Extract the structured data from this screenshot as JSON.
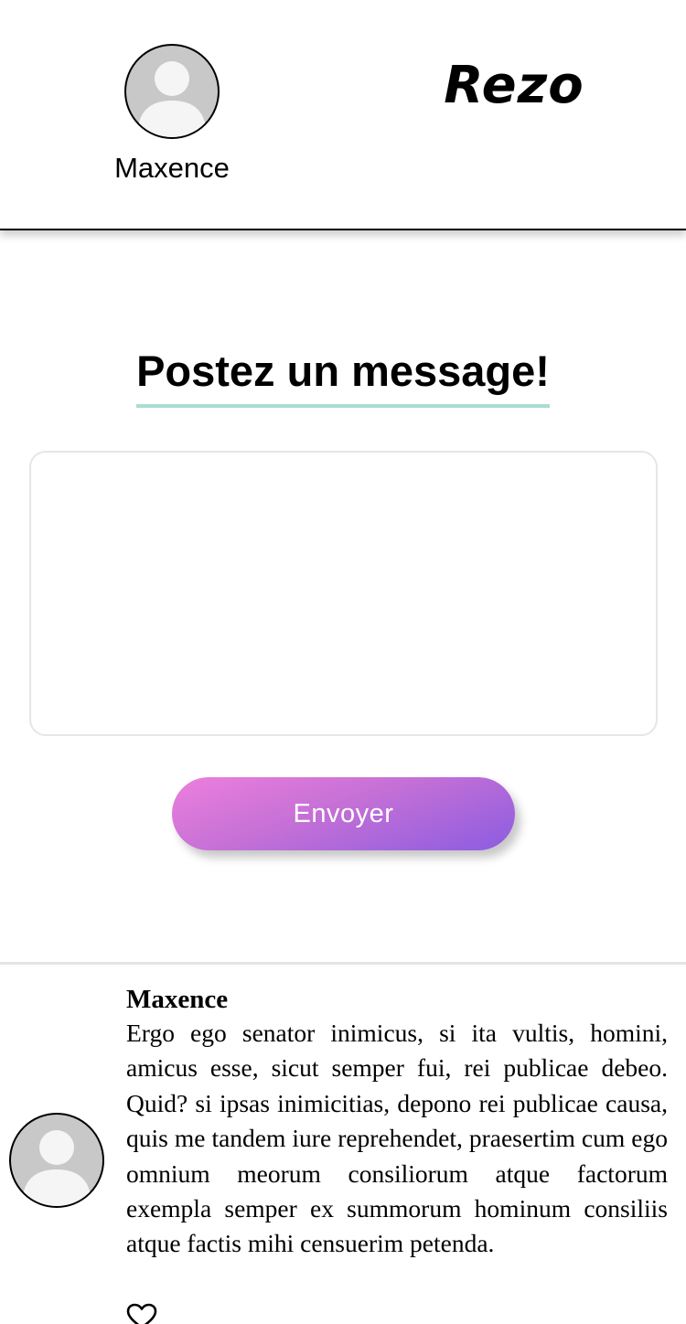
{
  "header": {
    "profile": {
      "name": "Maxence",
      "avatar_icon": "user-avatar-icon"
    },
    "brand": "Rezo"
  },
  "compose": {
    "title": "Postez un message!",
    "message_value": "",
    "send_label": "Envoyer"
  },
  "feed": {
    "posts": [
      {
        "author": "Maxence",
        "text": "Ergo ego senator inimicus, si ita vultis, homini, amicus esse, sicut semper fui, rei publicae debeo. Quid? si ipsas inimicitias, depono rei publicae causa, quis me tandem iure reprehendet, praesertim cum ego omnium meorum consiliorum atque factorum exempla semper ex summorum hominum consiliis atque factis mihi censuerim petenda.",
        "avatar_icon": "user-avatar-icon",
        "like_icon": "heart-outline-icon"
      }
    ]
  },
  "colors": {
    "title_underline": "#a9ddd3",
    "button_gradient_start": "#ec7fdd",
    "button_gradient_end": "#8c5ce0",
    "avatar_bg": "#c8c8c8",
    "avatar_silhouette": "#f5f5f5"
  }
}
